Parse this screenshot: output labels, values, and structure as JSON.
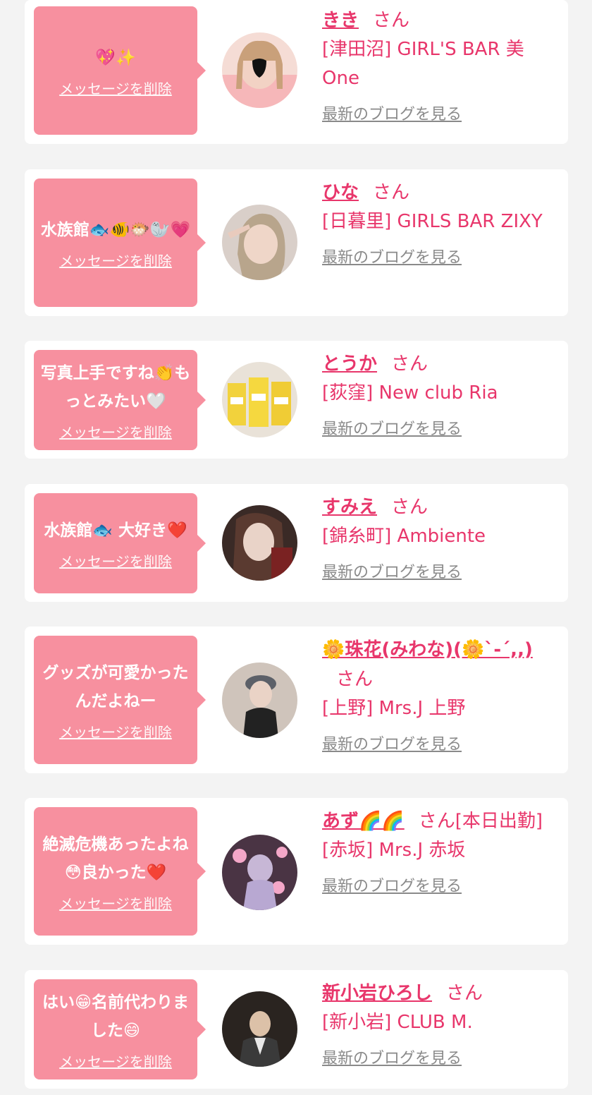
{
  "delete_label": "メッセージを削除",
  "blog_label": "最新のブログを見る",
  "san_label": "さん",
  "colors": {
    "bubble": "#f7909f",
    "name": "#e8366b",
    "blog_link": "#8a8a8a",
    "background": "#f3f3f3"
  },
  "entries": [
    {
      "message": "💖✨",
      "name": "きき",
      "suffix": "さん",
      "shop": "[津田沼] GIRL'S BAR 美One"
    },
    {
      "message": "水族館🐟🐠🐡🦭💗",
      "name": "ひな",
      "suffix": "さん",
      "shop": "[日暮里] GIRLS BAR ZIXY"
    },
    {
      "message": "写真上手ですね👏もっとみたい🤍",
      "name": "とうか",
      "suffix": "さん",
      "shop": "[荻窪] New club Ria"
    },
    {
      "message": "水族館🐟 大好き❤️",
      "name": "すみえ",
      "suffix": "さん",
      "shop": "[錦糸町] Ambiente"
    },
    {
      "message": "グッズが可愛かったんだよねー",
      "name": "🌼珠花(みわな)(🌼ˋ-ˊ,,)",
      "suffix": "さん",
      "shop": "[上野] Mrs.J 上野"
    },
    {
      "message": "絶滅危機あったよね😳良かった❤️",
      "name": "あず🌈🌈",
      "suffix": "さん[本日出勤]",
      "shop": "[赤坂] Mrs.J 赤坂"
    },
    {
      "message": "はい😁名前代わりました😄",
      "name": "新小岩ひろし",
      "suffix": "さん",
      "shop": "[新小岩] CLUB M."
    }
  ]
}
